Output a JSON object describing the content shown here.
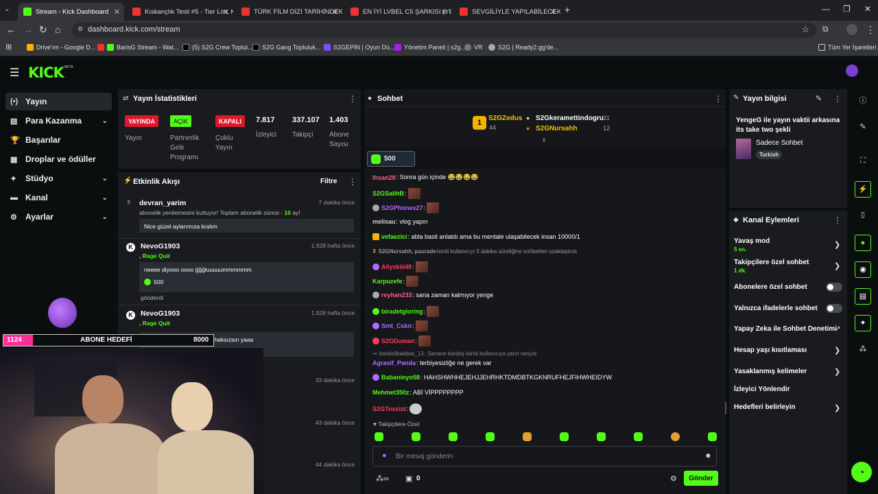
{
  "browser": {
    "tabs": [
      {
        "title": "Stream - Kick Dashboard"
      },
      {
        "title": "Kıskançlık Testi #5 - Tier List, Kı"
      },
      {
        "title": "TÜRK FİLM DİZİ TARİHİNDEKİ E"
      },
      {
        "title": "EN İYİ LVBEL C5 ŞARKISI (YENİ)"
      },
      {
        "title": "SEVGİLİYLE YAPILABİLECEK AK"
      }
    ],
    "url": "dashboard.kick.com/stream",
    "bookmarks": [
      "Drive'ım - Google D...",
      "BarisG Stream - Wat...",
      "(5) S2G Crew Toplul...",
      "S2G Gang Topluluk...",
      "S2GEPIN | Oyun Dü...",
      "Yönetim Paneli | s2g...",
      "VR",
      "S2G | Ready2.gg'de..."
    ],
    "bookmarks_all": "Tüm Yer İşaretleri"
  },
  "kick": {
    "logo": "KICK",
    "beta": "BETA",
    "accent": "#53fc18"
  },
  "sidebar": {
    "items": [
      {
        "label": "Yayın",
        "icon": "broadcast-icon"
      },
      {
        "label": "Para Kazanma",
        "icon": "money-icon"
      },
      {
        "label": "Başarılar",
        "icon": "trophy-icon"
      },
      {
        "label": "Droplar ve ödüller",
        "icon": "gift-icon"
      },
      {
        "label": "Stüdyo",
        "icon": "studio-icon"
      },
      {
        "label": "Kanal",
        "icon": "channel-icon"
      },
      {
        "label": "Ayarlar",
        "icon": "gear-icon"
      }
    ]
  },
  "stats": {
    "title": "Yayın İstatistikleri",
    "live_badge": "YAYINDA",
    "live_label": "Yayın",
    "partner_badge": "AÇIK",
    "partner_label": [
      "Partnerlik",
      "Gelir",
      "Programı"
    ],
    "multi_badge": "KAPALI",
    "multi_label": [
      "Çoklu",
      "Yayın"
    ],
    "viewers": "7.817",
    "viewers_label": "İzleyici",
    "followers": "337.107",
    "followers_label": "Takipçi",
    "subs": "1.403",
    "subs_label": [
      "Abone",
      "Sayısı"
    ]
  },
  "activity": {
    "title": "Etkinlik Akışı",
    "filter": "Filtre",
    "items": [
      {
        "name": "devran_yarim",
        "time": "7 dakika önce",
        "sub_a": "abonelik yenilemesini kutluyor! Toplam abonelik süresi - ",
        "sub_b": "10",
        "sub_c": " ay!",
        "msg": "Nice güzel aylarımıza kralım"
      },
      {
        "name": "NevoG1903",
        "time": "1.928 hafta önce",
        "tag": "Rage Quit",
        "msg": "neeee diyooo oooo ğğğluuuuummmmmm",
        "amount": "500",
        "footer": "gönderdi"
      },
      {
        "name": "NevoG1903",
        "time": "1.928 hafta önce",
        "tag": "Rage Quit",
        "msg": "seni hiç dinlemedim bence haksızsın yaaa"
      },
      {
        "time": "33 dakika önce"
      },
      {
        "time": "43 dakika önce"
      },
      {
        "time": "44 dakika önce"
      }
    ]
  },
  "chat": {
    "title": "Sohbet",
    "top": [
      {
        "rank": "1",
        "name": "S2GZedus",
        "count": "44"
      },
      {
        "name": "S2Gkeramettindogru",
        "count": "31"
      },
      {
        "name": "S2GNursahh",
        "count": "12"
      }
    ],
    "pinned_amount": "500",
    "messages": [
      {
        "user": "Ihsan28",
        "text": ": Sonra gün içinde 😂😂😂😂",
        "color": "#ff5c8a"
      },
      {
        "user": "S2GSalihB",
        "text": ":",
        "color": "#53fc18",
        "emote": true
      },
      {
        "user": "S2GPhonex27",
        "text": ":",
        "color": "#b06cff",
        "emote": true
      },
      {
        "user": "melisau",
        "text": ": vlog yapın",
        "color": "#cfcfcf"
      },
      {
        "user": "vefaezici",
        "text": ": abla basit anlatdı ama bu mentale ulaşabilecek insan 10000/1",
        "color": "#53fc18"
      },
      {
        "user": "S2GNursahh, paurade",
        "text": " isimli kullanıcıyı 5 dakika süreliğine sohbetten uzaklaştırdı",
        "color": "#9a9a9a",
        "system": true
      },
      {
        "user": "Aliyskiii48",
        "text": ":",
        "color": "#ff3c5c",
        "emote": true
      },
      {
        "user": "Karpuzefe",
        "text": ":",
        "color": "#53fc18",
        "emote": true
      },
      {
        "user": "reyhan233",
        "text": ": sana zaman kalmıyor yenge",
        "color": "#ff5c8a"
      },
      {
        "user": "biradetgloring",
        "text": ":",
        "color": "#53fc18",
        "emote": true
      },
      {
        "user": "Smt_Cskn",
        "text": ":",
        "color": "#b06cff",
        "emote": true
      },
      {
        "user": "S2GDuman",
        "text": ":",
        "color": "#ff3c5c",
        "emote": true
      },
      {
        "user": "basbirilbaddas_13",
        "text": ": Sanane kardeş isimli kullanıcıya yanıt veriyor",
        "color": "#8a8a8a",
        "system": true
      },
      {
        "user": "Agrasif_Panda",
        "text": ": terbiyesizliğe ne gerek var",
        "color": "#b06cff"
      },
      {
        "user": "Babaninyo58",
        "text": ": HAHSHWHHEJEHJJEHRHKTDMDBTKGKNRUFHEJFIHWHEIDYW",
        "color": "#53fc18"
      },
      {
        "user": "Mehmet350z",
        "text": ": ABİ VİPPPPPPPP",
        "color": "#53fc18"
      },
      {
        "user": "S2GToxsist",
        "text": ":",
        "color": "#ff3c5c",
        "emote": true
      }
    ],
    "followers_only": "Takipçilere Özel",
    "input_placeholder": "Bir mesaj gönderin",
    "points": "0",
    "send": "Gönder"
  },
  "stream_info": {
    "title": "Yayın bilgisi",
    "stream_title": "YengeG ile yayın vaktii arkasına its take two şekli",
    "category": "Sadece Sohbet",
    "language": "Turkish"
  },
  "channel_actions": {
    "title": "Kanal Eylemleri",
    "items": [
      {
        "label": "Yavaş mod",
        "sub": "5 sn.",
        "control": "arrow"
      },
      {
        "label": "Takipçilere özel sohbet",
        "sub": "1 dk.",
        "control": "arrow"
      },
      {
        "label": "Abonelere özel sohbet",
        "control": "toggle"
      },
      {
        "label": "Yalnızca ifadelerle sohbet",
        "control": "toggle"
      },
      {
        "label": "Yapay Zeka ile Sohbet Denetimi",
        "control": "external"
      },
      {
        "label": "Hesap yaşı kısıtlaması",
        "control": "arrow"
      },
      {
        "label": "Yasaklanmış kelimeler",
        "control": "arrow"
      },
      {
        "label": "İzleyici Yönlendir",
        "control": "none"
      },
      {
        "label": "Hedefleri belirleyin",
        "control": "arrow"
      }
    ]
  },
  "overlay": {
    "sub_count": "1124",
    "sub_goal_label": "ABONE HEDEFİ",
    "sub_goal": "8000",
    "sub_goal_progress": 0.14
  }
}
